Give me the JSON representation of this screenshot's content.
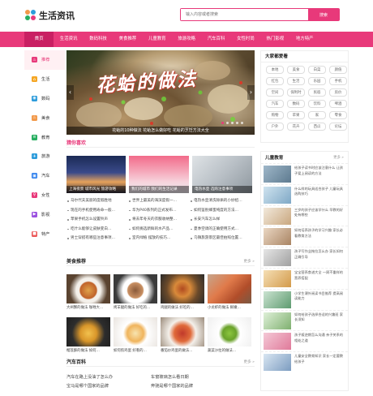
{
  "header": {
    "logo_text": "生活资讯",
    "search_placeholder": "输入内容或者搜索",
    "search_button": "搜索"
  },
  "nav": {
    "items": [
      "首页",
      "生活资讯",
      "数码科技",
      "美食推荐",
      "儿童教育",
      "旅游攻略",
      "汽车百科",
      "女性时尚",
      "热门影视",
      "地方特产"
    ]
  },
  "sidebar": {
    "items": [
      {
        "label": "推荐",
        "icon": "fire-icon",
        "color": "#e8397a"
      },
      {
        "label": "生活",
        "icon": "home-icon",
        "color": "#f5a623"
      },
      {
        "label": "数码",
        "icon": "camera-icon",
        "color": "#2d9cdb"
      },
      {
        "label": "美食",
        "icon": "food-icon",
        "color": "#f2994a"
      },
      {
        "label": "教育",
        "icon": "book-icon",
        "color": "#27ae60"
      },
      {
        "label": "旅游",
        "icon": "plane-icon",
        "color": "#2d9cdb"
      },
      {
        "label": "汽车",
        "icon": "car-icon",
        "color": "#2f80ed"
      },
      {
        "label": "女性",
        "icon": "female-icon",
        "color": "#e8397a"
      },
      {
        "label": "影视",
        "icon": "film-icon",
        "color": "#9b51e0"
      },
      {
        "label": "特产",
        "icon": "gift-icon",
        "color": "#eb5757"
      }
    ]
  },
  "banner": {
    "title": "花蛤的做法",
    "caption": "花蛤的10种做法 花蛤怎么做好吃 花蛤的烹饪方法大全",
    "prev": "‹",
    "next": "›"
  },
  "guess": {
    "title": "猜你喜欢",
    "thumbs": [
      {
        "caption": "上海夜景 城市风光 旅游攻略"
      },
      {
        "caption": "我们的城市 我们的生活记录"
      },
      {
        "caption": "电热水壶 选购注意事项"
      }
    ],
    "news": [
      "马尔代夫美丽的度假胜地",
      "世界上最美的海滨度假一…",
      "电热水壶清洗除垢的小妙招…",
      "现在的手机使用寿命一般…",
      "华为P40系列的正式发布…",
      "如何鉴别蜂蜜纯度的方法…",
      "苹果手机怎么设置铃声",
      "将去年冬天的衣服收纳整…",
      "长安汽车怎么样",
      "吃什么能够让皮肤变白…",
      "如何挑选新鲜的水产品…",
      "夏季空调的正确使用方式…",
      "男士穿搭有哪些注意事项…",
      "室内绿植 摆放的技巧…",
      "乌镇旅游景区最佳拍照位置…"
    ]
  },
  "food": {
    "title": "美食推荐",
    "more": "更多 »",
    "items": [
      {
        "caption": "大闸蟹的做法 咖喱大…"
      },
      {
        "caption": "烤羊腿的做法 好吃的…"
      },
      {
        "caption": "鸡腿的做法 好吃的…"
      },
      {
        "caption": "小龙虾的做法 鲜嫩…"
      },
      {
        "caption": "榴莲酥的做法 如何…"
      },
      {
        "caption": "如何煎鸡蛋 好看的…"
      },
      {
        "caption": "番茄炒鸡蛋的做法…"
      },
      {
        "caption": "蔬菜沙拉的做法…"
      }
    ]
  },
  "car": {
    "title": "汽车百科",
    "more": "更多 »",
    "items": [
      "汽车在路上没油了怎么办",
      "车窗玻璃怎么看日期",
      "宝马是哪个国家的品牌",
      "奔驰是哪个国家的品牌"
    ]
  },
  "hot_search": {
    "title": "大家都爱看",
    "tags": [
      "本地",
      "美食",
      "白菜",
      "颜值",
      "红包",
      "生活",
      "乐园",
      "手机",
      "空间",
      "保利时",
      "民宿",
      "房价",
      "汽车",
      "数码",
      "饮料",
      "啤酒",
      "购物",
      "苹果",
      "家",
      "零食",
      "户外",
      "花卉",
      "西瓜",
      "论坛"
    ]
  },
  "kids": {
    "title": "儿童教育",
    "more": "更多 »",
    "items": [
      "给孩子读书时应该注意什么 让孩子爱上阅读的方法",
      "什么样的玩具适合孩子 儿童玩具选购技巧",
      "三岁的孩子应该学什么 早教的好处有哪些",
      "如何培养孩子的学习兴趣 家长必看教育方法",
      "孩子写作业拖拉怎么办 家长如何正确引导",
      "宝宝营养食谱大全 一周不重样的营养搭配",
      "小学生课外阅读书目推荐 提高阅读能力",
      "如何给孩子选择合适的兴趣班 家长须知",
      "孩子叛逆期怎么沟通 亲子关系的相处之道",
      "儿童安全教育知识 家长一定要教给孩子"
    ]
  },
  "colors": {
    "accent": "#e8397a",
    "accent_dark": "#c92063"
  }
}
